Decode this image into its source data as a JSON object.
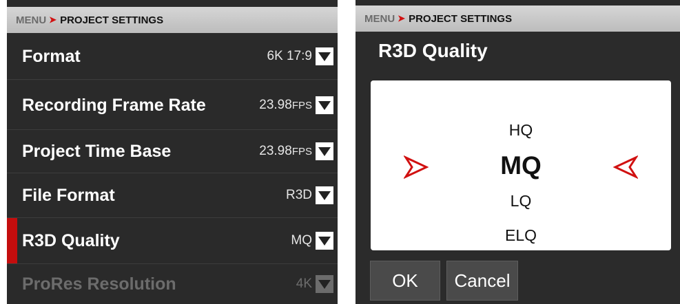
{
  "left_panel": {
    "breadcrumb": {
      "menu": "MENU",
      "separator": "➤",
      "page": "PROJECT SETTINGS"
    },
    "rows": [
      {
        "label": "Format",
        "value": "6K 17:9",
        "unit": ""
      },
      {
        "label": "Recording Frame Rate",
        "value": "23.98",
        "unit": "FPS"
      },
      {
        "label": "Project Time Base",
        "value": "23.98",
        "unit": "FPS"
      },
      {
        "label": "File Format",
        "value": "R3D",
        "unit": ""
      },
      {
        "label": "R3D Quality",
        "value": "MQ",
        "unit": "",
        "selected": true
      },
      {
        "label": "ProRes Resolution",
        "value": "4K",
        "unit": "",
        "disabled": true
      }
    ]
  },
  "right_panel": {
    "breadcrumb": {
      "menu": "MENU",
      "separator": "➤",
      "page": "PROJECT SETTINGS"
    },
    "title": "R3D Quality",
    "options": [
      "HQ",
      "MQ",
      "LQ",
      "ELQ"
    ],
    "selected": "MQ",
    "ok_label": "OK",
    "cancel_label": "Cancel"
  },
  "colors": {
    "accent": "#c40d0d",
    "background": "#2b2b2b",
    "header": "#c8c8c8"
  }
}
